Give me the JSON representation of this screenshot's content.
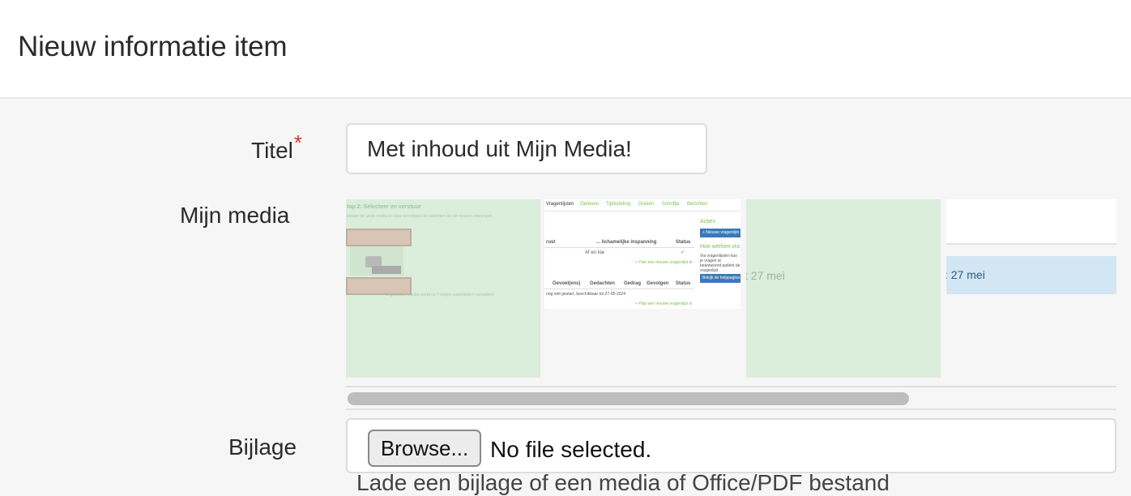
{
  "header": {
    "title": "Nieuw informatie item"
  },
  "form": {
    "title_label": "Titel",
    "required_mark": "*",
    "title_value": "Met inhoud uit Mijn Media!",
    "media_label": "Mijn media",
    "attachment_label": "Bijlage",
    "browse_label": "Browse...",
    "file_status": "No file selected.",
    "help_text_partial": "Lade een bijlage of een media of Office/PDF bestand"
  },
  "media": {
    "thumb1": {
      "heading": "tap 2: Selecteer en verstuur",
      "subtext": "lecteer de juiste media en kies vervolgens de patiënten die dit moeten ontvangen.",
      "footer": "Ongebruikte media wordt na 7 dagen automatisch verwijderd"
    },
    "thumb2": {
      "tabs": [
        "Vragenlijsten",
        "Oefenen",
        "Tijdindeling",
        "Doelen",
        "Schriftje",
        "Berichten"
      ],
      "acties": "Acties",
      "nieuwe_btn": "+ Nieuwe vragenlijst",
      "hoe_werken": "Hoe werken vra",
      "hoe_text": "Via vragenlijsten kun je vragen te beantwoord patiënt de vragenlijst",
      "help_btn": "Bekijk de helppagina",
      "row1_headers": [
        "rust",
        "... lichamelijke inspanning",
        "Status"
      ],
      "row1_value": "Af en toe",
      "plan_link": "+ Plan een nieuwe vragenlijst in",
      "row2_headers": [
        "Gevoel(ens)",
        "Gedachten",
        "Gedrag",
        "Gevolgen",
        "Status"
      ],
      "row2_value": "nog niet gestart, beschikbaar tot 27-05-2024",
      "plan_link2": "+ Plan een nieuwe vragenlijst in"
    },
    "thumb3": {
      "text": "t 27 mei"
    },
    "thumb4": {
      "text": ": 27 mei"
    }
  },
  "colors": {
    "thumb_green": "#dbeddb",
    "required": "#d9342b",
    "accent_green": "#7cc04b",
    "button_blue": "#3a7ab8"
  }
}
